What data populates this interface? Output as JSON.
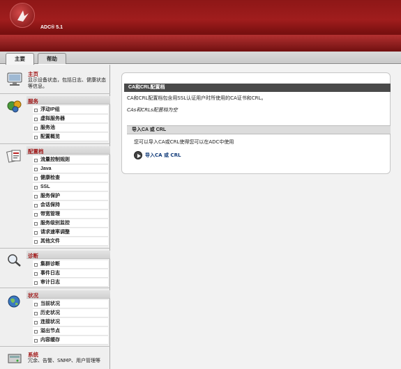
{
  "brand": "ADC® 5.1",
  "tabs": [
    "主要",
    "帮助"
  ],
  "sidebar": {
    "home": {
      "title": "主页",
      "desc": "显示设备状态，包括日志、健康状态等信息。"
    },
    "services": {
      "title": "服务",
      "items": [
        "浮动IP组",
        "虚拟服务器",
        "服务池",
        "配置概览"
      ]
    },
    "profiles": {
      "title": "配置档",
      "items": [
        "流量控制规则",
        "Java",
        "健康检查",
        "SSL",
        "服务保护",
        "会话保持",
        "带宽管理",
        "服务级别监控",
        "请求速率调整",
        "其他文件"
      ]
    },
    "diagnose": {
      "title": "诊断",
      "items": [
        "集群诊断",
        "事件日志",
        "审计日志"
      ]
    },
    "status": {
      "title": "状况",
      "items": [
        "当前状况",
        "历史状况",
        "连接状况",
        "溢出节点",
        "内容缓存"
      ]
    },
    "system": {
      "title": "系统",
      "desc": "冗余、告警、SNMP、用户管理等"
    }
  },
  "main": {
    "title": "CA和CRL配置档",
    "desc": "CA和CRL配置档包含用SSL认证用户时所使用的CA证书和CRL。",
    "empty_note": "CAs和CRLs配置档为空",
    "import_header": "导入CA 或 CRL",
    "import_desc": "您可以导入CA或CRL使得您可以在ADC中使用",
    "import_link": "导入CA 或 CRL"
  },
  "colors": {
    "header": "#8e1717",
    "accent": "#a01818",
    "title_bar": "#4a4a4a"
  }
}
